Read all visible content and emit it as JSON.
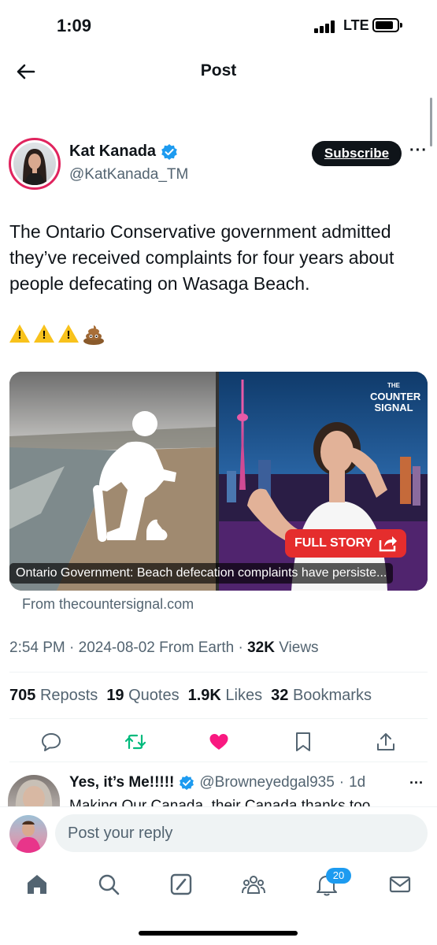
{
  "status_bar": {
    "time": "1:09",
    "network": "LTE"
  },
  "header": {
    "title": "Post"
  },
  "post": {
    "author_name": "Kat Kanada",
    "author_handle": "@KatKanada_TM",
    "subscribe_label": "Subscribe",
    "text": "The Ontario Conservative government admitted they’ve received complaints for four years about people defecating on Wasaga Beach.",
    "emojis": [
      "warning",
      "warning",
      "warning",
      "pile-of-poo"
    ],
    "card": {
      "caption": "Ontario Government: Beach defecation complaints have persiste...",
      "source": "From thecountersignal.com",
      "brand_line1": "THE",
      "brand_line2": "COUNTER",
      "brand_line3": "SIGNAL",
      "cta_label": "FULL STORY"
    },
    "time": "2:54 PM",
    "date": "2024-08-02",
    "location": "From Earth",
    "views_count": "32K",
    "views_label": "Views",
    "stats": {
      "reposts_count": "705",
      "reposts_label": "Reposts",
      "quotes_count": "19",
      "quotes_label": "Quotes",
      "likes_count": "1.9K",
      "likes_label": "Likes",
      "bookmarks_count": "32",
      "bookmarks_label": "Bookmarks"
    }
  },
  "reply": {
    "name": "Yes, it’s Me!!!!!",
    "handle": "@Browneyedgal935",
    "age": "1d",
    "text": "Making Our Canada, their Canada thanks too"
  },
  "composer": {
    "placeholder": "Post your reply"
  },
  "tabbar": {
    "notifications_badge": "20"
  },
  "colors": {
    "accent": "#1d9bf0",
    "like": "#f91880",
    "repost": "#00ba7c",
    "text_secondary": "#536471",
    "cta": "#e52d2d"
  }
}
